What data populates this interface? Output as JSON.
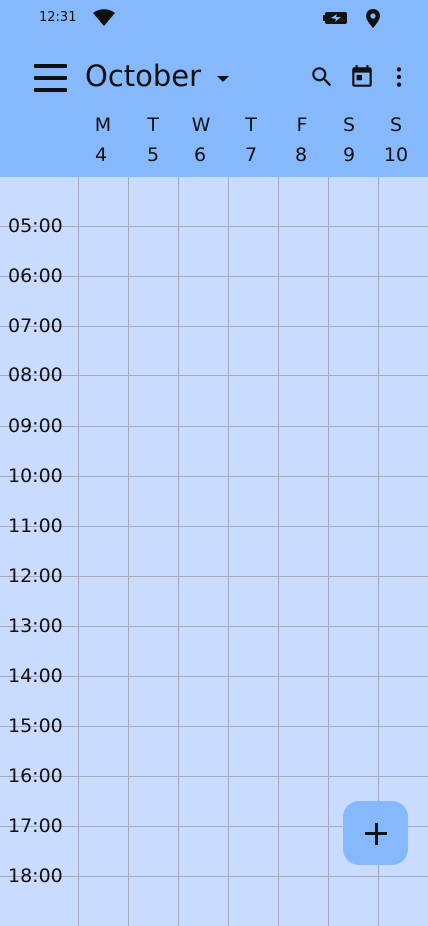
{
  "status_bar": {
    "time": "12:31"
  },
  "header": {
    "month": "October"
  },
  "week": {
    "days": [
      {
        "weekday": "M",
        "date": "4"
      },
      {
        "weekday": "T",
        "date": "5"
      },
      {
        "weekday": "W",
        "date": "6"
      },
      {
        "weekday": "T",
        "date": "7"
      },
      {
        "weekday": "F",
        "date": "8"
      },
      {
        "weekday": "S",
        "date": "9"
      },
      {
        "weekday": "S",
        "date": "10"
      }
    ]
  },
  "timeline": {
    "hours": [
      "05:00",
      "06:00",
      "07:00",
      "08:00",
      "09:00",
      "10:00",
      "11:00",
      "12:00",
      "13:00",
      "14:00",
      "15:00",
      "16:00",
      "17:00",
      "18:00"
    ]
  },
  "icons": {
    "menu": "menu-icon",
    "search": "search-icon",
    "calendar": "calendar-today-icon",
    "more": "more-vert-icon",
    "add": "add-icon"
  },
  "colors": {
    "header_bg": "#86b9fb",
    "grid_bg": "#c9dbff",
    "grid_line": "#a3abb8"
  }
}
